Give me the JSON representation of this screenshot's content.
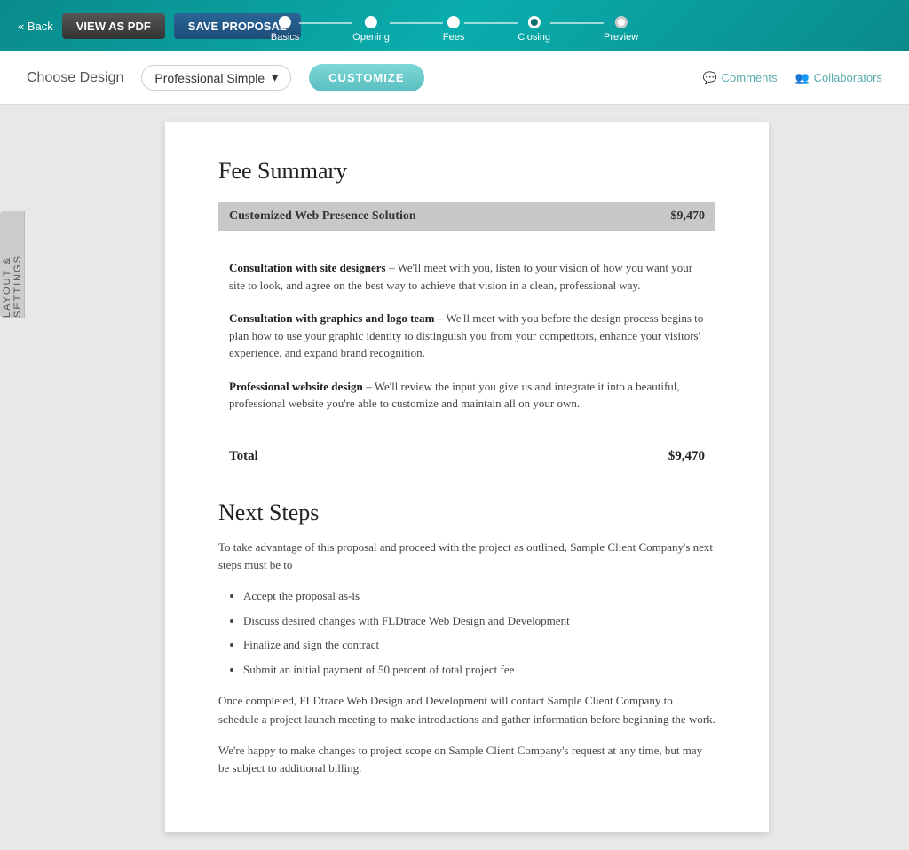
{
  "topbar": {
    "back_label": "« Back",
    "view_pdf_label": "VIEW AS PDF",
    "save_proposal_label": "SAVE PROPOSAL",
    "steps": [
      {
        "label": "Basics",
        "state": "completed"
      },
      {
        "label": "Opening",
        "state": "completed"
      },
      {
        "label": "Fees",
        "state": "completed"
      },
      {
        "label": "Closing",
        "state": "active"
      },
      {
        "label": "Preview",
        "state": "upcoming"
      }
    ]
  },
  "subheader": {
    "title": "Choose Design",
    "design_selected": "Professional Simple",
    "customize_label": "CUSTOMIZE",
    "comments_label": "Comments",
    "collaborators_label": "Collaborators"
  },
  "sidebar": {
    "tab_label": "LAYOUT & SETTINGS"
  },
  "document": {
    "fee_summary": {
      "heading": "Fee Summary",
      "package_name": "Customized Web Presence Solution",
      "package_price": "$9,470",
      "items": [
        {
          "title": "Consultation with site designers",
          "desc": "– We'll meet with you, listen to your vision of how you want your site to look, and agree on the best way to achieve that vision in a clean, professional way."
        },
        {
          "title": "Consultation with graphics and logo team",
          "desc": "– We'll meet with you before the design process begins to plan how to use your graphic identity to distinguish you from your competitors, enhance your visitors' experience, and expand brand recognition."
        },
        {
          "title": "Professional website design",
          "desc": "– We'll review the input you give us and integrate it into a beautiful, professional website you're able to customize and maintain all on your own."
        }
      ],
      "total_label": "Total",
      "total_value": "$9,470"
    },
    "next_steps": {
      "heading": "Next Steps",
      "intro": "To take advantage of this proposal and proceed with the project as outlined, Sample Client Company's next steps must be to",
      "steps": [
        "Accept the proposal as-is",
        "Discuss desired changes with FLDtrace Web Design and Development",
        "Finalize and sign the contract",
        "Submit an initial payment of 50 percent of total project fee"
      ],
      "outro1": "Once completed, FLDtrace Web Design and Development will contact Sample Client Company to schedule a project launch meeting to make introductions and gather information before beginning the work.",
      "outro2": "We're happy to make changes to project scope on Sample Client Company's request at any time, but may be subject to additional billing."
    }
  }
}
